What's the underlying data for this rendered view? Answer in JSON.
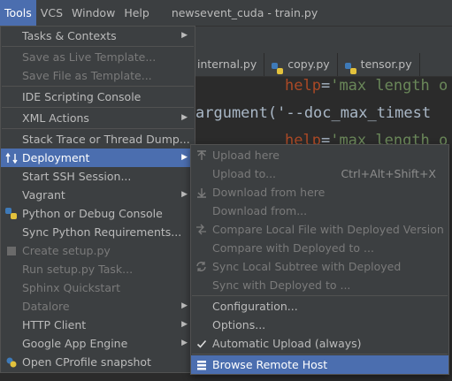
{
  "menubar": {
    "items": [
      "Tools",
      "VCS",
      "Window",
      "Help"
    ],
    "window_title": "newsevent_cuda - train.py"
  },
  "tabs": [
    "internal.py",
    "copy.py",
    "tensor.py"
  ],
  "code": {
    "line1": {
      "param": "help",
      "eq": "=",
      "str": "'max length o"
    },
    "line2": {
      "text": "argument('--doc_max_timest"
    },
    "line3": {
      "param": "help",
      "eq": "=",
      "str": "'max length o"
    }
  },
  "tools_menu": {
    "items": [
      {
        "label": "Tasks & Contexts",
        "enabled": true,
        "submenu": true
      },
      {
        "label": "Save as Live Template...",
        "enabled": false
      },
      {
        "label": "Save File as Template...",
        "enabled": false
      },
      {
        "label": "IDE Scripting Console",
        "enabled": true
      },
      {
        "label": "XML Actions",
        "enabled": true,
        "submenu": true
      },
      {
        "label": "Stack Trace or Thread Dump...",
        "enabled": true
      },
      {
        "label": "Deployment",
        "enabled": true,
        "submenu": true,
        "selected": true,
        "icon": "deployment-icon"
      },
      {
        "label": "Start SSH Session...",
        "enabled": true
      },
      {
        "label": "Vagrant",
        "enabled": true,
        "submenu": true
      },
      {
        "label": "Python or Debug Console",
        "enabled": true,
        "icon": "python-icon"
      },
      {
        "label": "Sync Python Requirements...",
        "enabled": true
      },
      {
        "label": "Create setup.py",
        "enabled": false,
        "icon": "setup-icon"
      },
      {
        "label": "Run setup.py Task...",
        "enabled": false
      },
      {
        "label": "Sphinx Quickstart",
        "enabled": false
      },
      {
        "label": "Datalore",
        "enabled": false,
        "submenu": true
      },
      {
        "label": "HTTP Client",
        "enabled": true,
        "submenu": true
      },
      {
        "label": "Google App Engine",
        "enabled": true,
        "submenu": true
      },
      {
        "label": "Open CProfile snapshot",
        "enabled": true,
        "icon": "profiler-icon"
      }
    ]
  },
  "deployment_menu": {
    "items": [
      {
        "label": "Upload here",
        "enabled": false,
        "icon": "upload-icon"
      },
      {
        "label": "Upload to...",
        "enabled": false,
        "shortcut": "Ctrl+Alt+Shift+X"
      },
      {
        "label": "Download from here",
        "enabled": false,
        "icon": "download-icon"
      },
      {
        "label": "Download from...",
        "enabled": false
      },
      {
        "label": "Compare Local File with Deployed Version",
        "enabled": false,
        "icon": "compare-icon"
      },
      {
        "label": "Compare with Deployed to ...",
        "enabled": false
      },
      {
        "label": "Sync Local Subtree with Deployed",
        "enabled": false,
        "icon": "sync-icon"
      },
      {
        "label": "Sync with Deployed to ...",
        "enabled": false
      },
      {
        "label": "Configuration...",
        "enabled": true
      },
      {
        "label": "Options...",
        "enabled": true
      },
      {
        "label": "Automatic Upload (always)",
        "enabled": true,
        "checked": true
      },
      {
        "label": "Browse Remote Host",
        "enabled": true,
        "selected": true,
        "icon": "remote-host-icon"
      }
    ]
  },
  "colors": {
    "selection": "#4b6eaf",
    "menu_bg": "#3c3f41",
    "editor_bg": "#2b2b2b",
    "param": "#aa4926",
    "string": "#6a8759"
  }
}
